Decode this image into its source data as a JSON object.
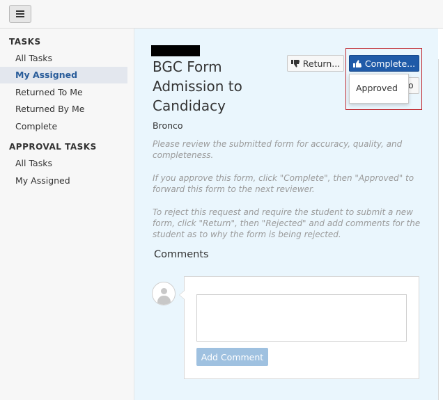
{
  "topbar": {
    "menu_icon": "hamburger-icon"
  },
  "sidebar": {
    "tasks_heading": "TASKS",
    "items": [
      {
        "label": "All Tasks",
        "active": false
      },
      {
        "label": "My Assigned",
        "active": true
      },
      {
        "label": "Returned To Me",
        "active": false
      },
      {
        "label": "Returned By Me",
        "active": false
      },
      {
        "label": "Complete",
        "active": false
      }
    ],
    "approval_heading": "APPROVAL TASKS",
    "approval_items": [
      {
        "label": "All Tasks"
      },
      {
        "label": "My Assigned"
      }
    ]
  },
  "main": {
    "title": "BGC Form Admission to Candidacy",
    "subject": "Bronco",
    "instructions": [
      "Please review the submitted form for accuracy, quality, and completeness.",
      "If you approve this form, click \"Complete\", then \"Approved\" to forward this form to the next reviewer.",
      "To reject this request and require the student to submit a new form, click \"Return\", then \"Rejected\" and add comments for the student as to why the form is being rejected."
    ],
    "comments_heading": "Comments",
    "comment_input_value": "",
    "add_comment_label": "Add Comment"
  },
  "actions": {
    "return_label": "Return...",
    "return_icon": "thumbs-down-icon",
    "complete_label": "Complete...",
    "complete_icon": "thumbs-up-icon",
    "hidden_button_fragment": "o",
    "dropdown_items": [
      {
        "label": "Approved"
      }
    ]
  },
  "colors": {
    "accent": "#1f5aa8",
    "main_bg": "#eaf6fd",
    "highlight": "#c0262d",
    "active_nav": "#2a5d9a"
  }
}
